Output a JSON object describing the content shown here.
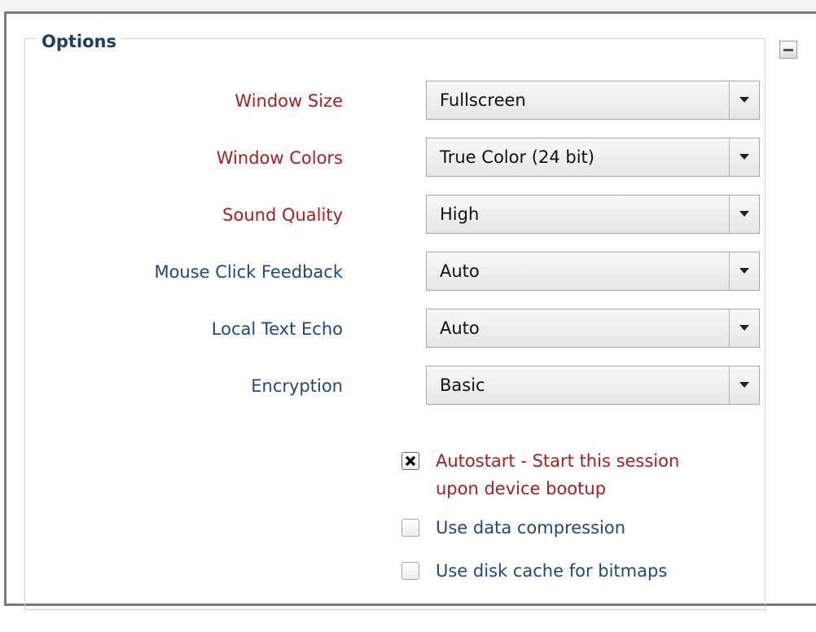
{
  "options": {
    "legend": "Options",
    "fields": [
      {
        "label": "Window Size",
        "value": "Fullscreen",
        "label_color": "#b01c1c"
      },
      {
        "label": "Window Colors",
        "value": "True Color (24 bit)",
        "label_color": "#b01c1c"
      },
      {
        "label": "Sound Quality",
        "value": "High",
        "label_color": "#b01c1c"
      },
      {
        "label": "Mouse Click Feedback",
        "value": "Auto",
        "label_color": "#1e4a7a"
      },
      {
        "label": "Local Text Echo",
        "value": "Auto",
        "label_color": "#1e4a7a"
      },
      {
        "label": "Encryption",
        "value": "Basic",
        "label_color": "#1e4a7a"
      }
    ],
    "checkboxes": [
      {
        "line1": "Autostart - Start this session",
        "line2": "upon device bootup",
        "checked": true
      },
      {
        "label": "Use data compression",
        "checked": false
      },
      {
        "label": "Use disk cache for bitmaps",
        "checked": false
      }
    ],
    "collapse_icon": "minus-icon",
    "dropdown_icon": "triangle-down-icon"
  }
}
